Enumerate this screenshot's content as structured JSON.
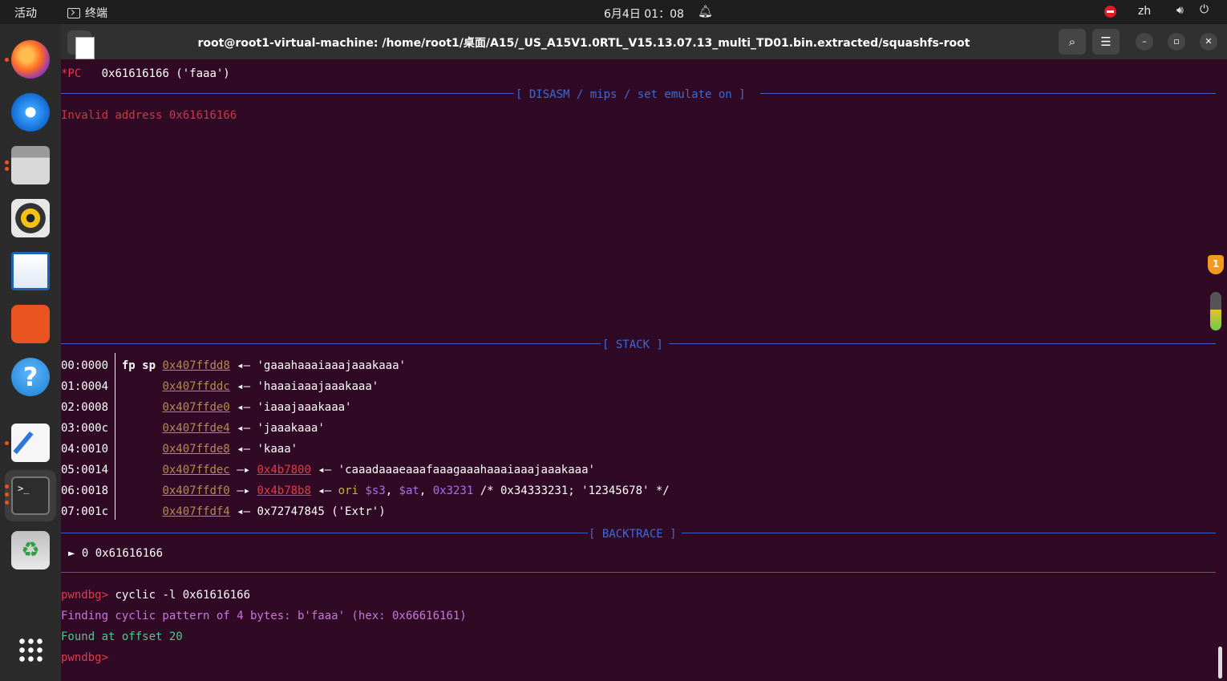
{
  "topbar": {
    "activities": "活动",
    "app_name": "终端",
    "clock": "6月4日  01：08",
    "lang": "zh"
  },
  "dock": {
    "items": [
      "firefox-icon",
      "thunderbird-icon",
      "files-icon",
      "rhythmbox-icon",
      "writer-icon",
      "software-store-icon",
      "help-icon",
      "text-editor-icon",
      "terminal-icon",
      "trash-icon",
      "app-grid-icon"
    ]
  },
  "window": {
    "title": "root@root1-virtual-machine: /home/root1/桌面/A15/_US_A15V1.0RTL_V15.13.07.13_multi_TD01.bin.extracted/squashfs-root"
  },
  "terminal": {
    "pc_label": "*PC",
    "pc_value": "0x61616166 ('faaa')",
    "disasm_header": "[ DISASM / mips / set emulate on ]",
    "invalid_addr": "Invalid address 0x61616166",
    "stack_header": "[ STACK ]",
    "stack": [
      {
        "idx": "00:0000",
        "regs": "fp sp",
        "addr": "0x407ffdd8",
        "arrow": "◂—",
        "rest": "'gaaahaaaiaaajaaakaaa'"
      },
      {
        "idx": "01:0004",
        "regs": "",
        "addr": "0x407ffddc",
        "arrow": "◂—",
        "rest": "'haaaiaaajaaakaaa'"
      },
      {
        "idx": "02:0008",
        "regs": "",
        "addr": "0x407ffde0",
        "arrow": "◂—",
        "rest": "'iaaajaaakaaa'"
      },
      {
        "idx": "03:000c",
        "regs": "",
        "addr": "0x407ffde4",
        "arrow": "◂—",
        "rest": "'jaaakaaa'"
      },
      {
        "idx": "04:0010",
        "regs": "",
        "addr": "0x407ffde8",
        "arrow": "◂—",
        "rest": "'kaaa'"
      },
      {
        "idx": "05:0014",
        "regs": "",
        "addr": "0x407ffdec",
        "arrow": "—▸",
        "ptr": "0x4b7800",
        "arrow2": "◂—",
        "rest": "'caaadaaaeaaafaaagaaahaaaiaaajaaakaaa'"
      },
      {
        "idx": "06:0018",
        "regs": "",
        "addr": "0x407ffdf0",
        "arrow": "—▸",
        "ptr": "0x4b78b8",
        "arrow2": "◂—",
        "ins": "ori",
        "r1": "$s3",
        "r2": "$at",
        "imm": "0x3231",
        "comment": "/* 0x34333231; '12345678' */"
      },
      {
        "idx": "07:001c",
        "regs": "",
        "addr": "0x407ffdf4",
        "arrow": "◂—",
        "rest": "0x72747845 ('Extr')"
      }
    ],
    "backtrace_header": "[ BACKTRACE ]",
    "backtrace": "► 0 0x61616166",
    "prompt": "pwndbg>",
    "command": "cyclic -l 0x61616166",
    "finding": "Finding cyclic pattern of 4 bytes: b'faaa' (hex: 0x66616161)",
    "found": "Found at offset 20"
  },
  "indicators": {
    "shield_count": "1",
    "level": 0.55
  },
  "colors": {
    "background": "#300a24",
    "accent": "#e95420",
    "red": "#e23b48",
    "blue": "#3a6bd6",
    "green": "#4ec98a",
    "magenta": "#c678dd"
  }
}
